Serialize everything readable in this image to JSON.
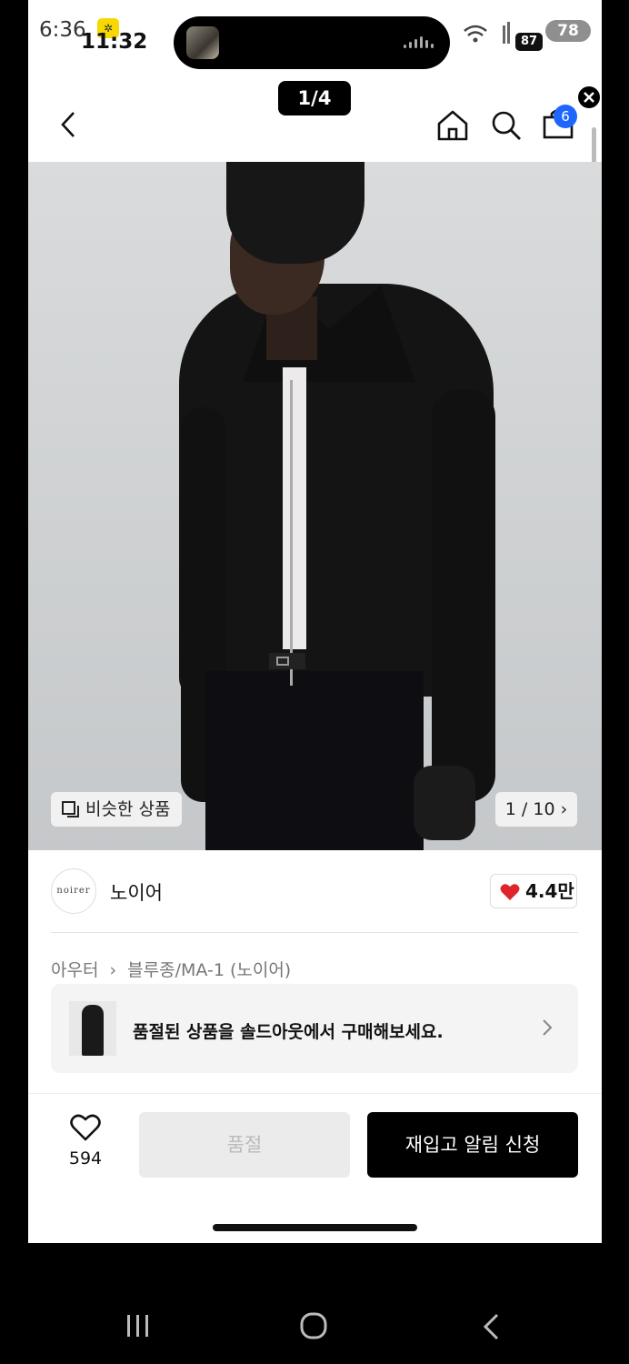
{
  "status_bar": {
    "time_primary": "6:36",
    "time_secondary": "11:32",
    "battery_small": "87",
    "battery_main": "78",
    "network": "lte"
  },
  "pager": {
    "label": "1/4"
  },
  "header": {
    "cart_count": "6"
  },
  "hero": {
    "similar_label": "비슷한 상품",
    "image_counter": "1 / 10 ›"
  },
  "brand": {
    "logo_text": "noirer",
    "name": "노이어",
    "likes": "4.4만"
  },
  "breadcrumb": {
    "category": "아우터",
    "separator": "›",
    "subcategory": "블루종/MA-1 (노이어)"
  },
  "banner": {
    "text": "품절된 상품을 솔드아웃에서 구매해보세요."
  },
  "bottom_bar": {
    "wish_count": "594",
    "soldout_label": "품절",
    "restock_label": "재입고 알림 신청"
  },
  "colors": {
    "accent_blue": "#1f66ff",
    "heart_red": "#e0242c",
    "primary_button": "#000000"
  }
}
